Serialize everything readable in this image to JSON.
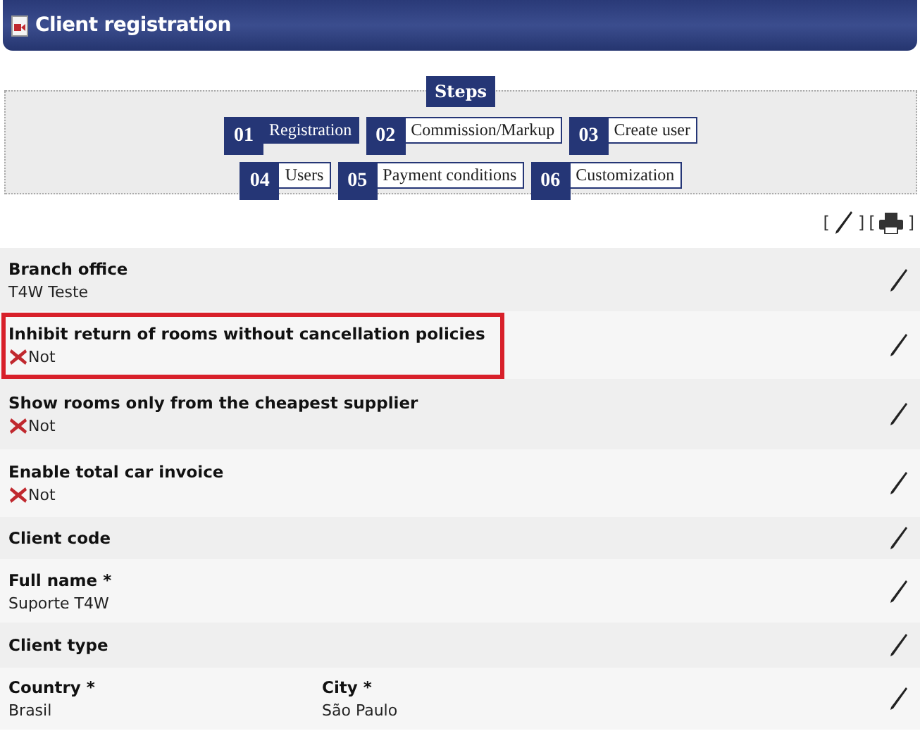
{
  "header": {
    "title": "Client registration"
  },
  "steps": {
    "title": "Steps",
    "rows": [
      [
        {
          "number": "01",
          "label": "Registration",
          "selected": true
        },
        {
          "number": "02",
          "label": "Commission/Markup",
          "selected": false
        },
        {
          "number": "03",
          "label": "Create user",
          "selected": false
        }
      ],
      [
        {
          "number": "04",
          "label": "Users",
          "selected": false
        },
        {
          "number": "05",
          "label": "Payment conditions",
          "selected": false
        },
        {
          "number": "06",
          "label": "Customization",
          "selected": false
        }
      ]
    ]
  },
  "toolbar": {
    "open_bracket_1": "[",
    "close_bracket_1": "]",
    "open_bracket_2": "[",
    "close_bracket_2": "]"
  },
  "fields": [
    {
      "kind": "text",
      "label": "Branch office",
      "value": "T4W Teste",
      "highlighted": false
    },
    {
      "kind": "flag",
      "label": "Inhibit return of rooms without cancellation policies",
      "value": "Not",
      "highlighted": true
    },
    {
      "kind": "flag",
      "label": "Show rooms only from the cheapest supplier",
      "value": "Not",
      "highlighted": false
    },
    {
      "kind": "flag",
      "label": "Enable total car invoice",
      "value": "Not",
      "highlighted": false
    },
    {
      "kind": "empty",
      "label": "Client code",
      "highlighted": false
    },
    {
      "kind": "text",
      "label": "Full name *",
      "value": "Suporte T4W",
      "highlighted": false
    },
    {
      "kind": "empty",
      "label": "Client type",
      "highlighted": false
    },
    {
      "kind": "pair",
      "label": "Country *",
      "value": "Brasil",
      "label_2": "City *",
      "value_2": "São Paulo",
      "highlighted": false
    }
  ]
}
